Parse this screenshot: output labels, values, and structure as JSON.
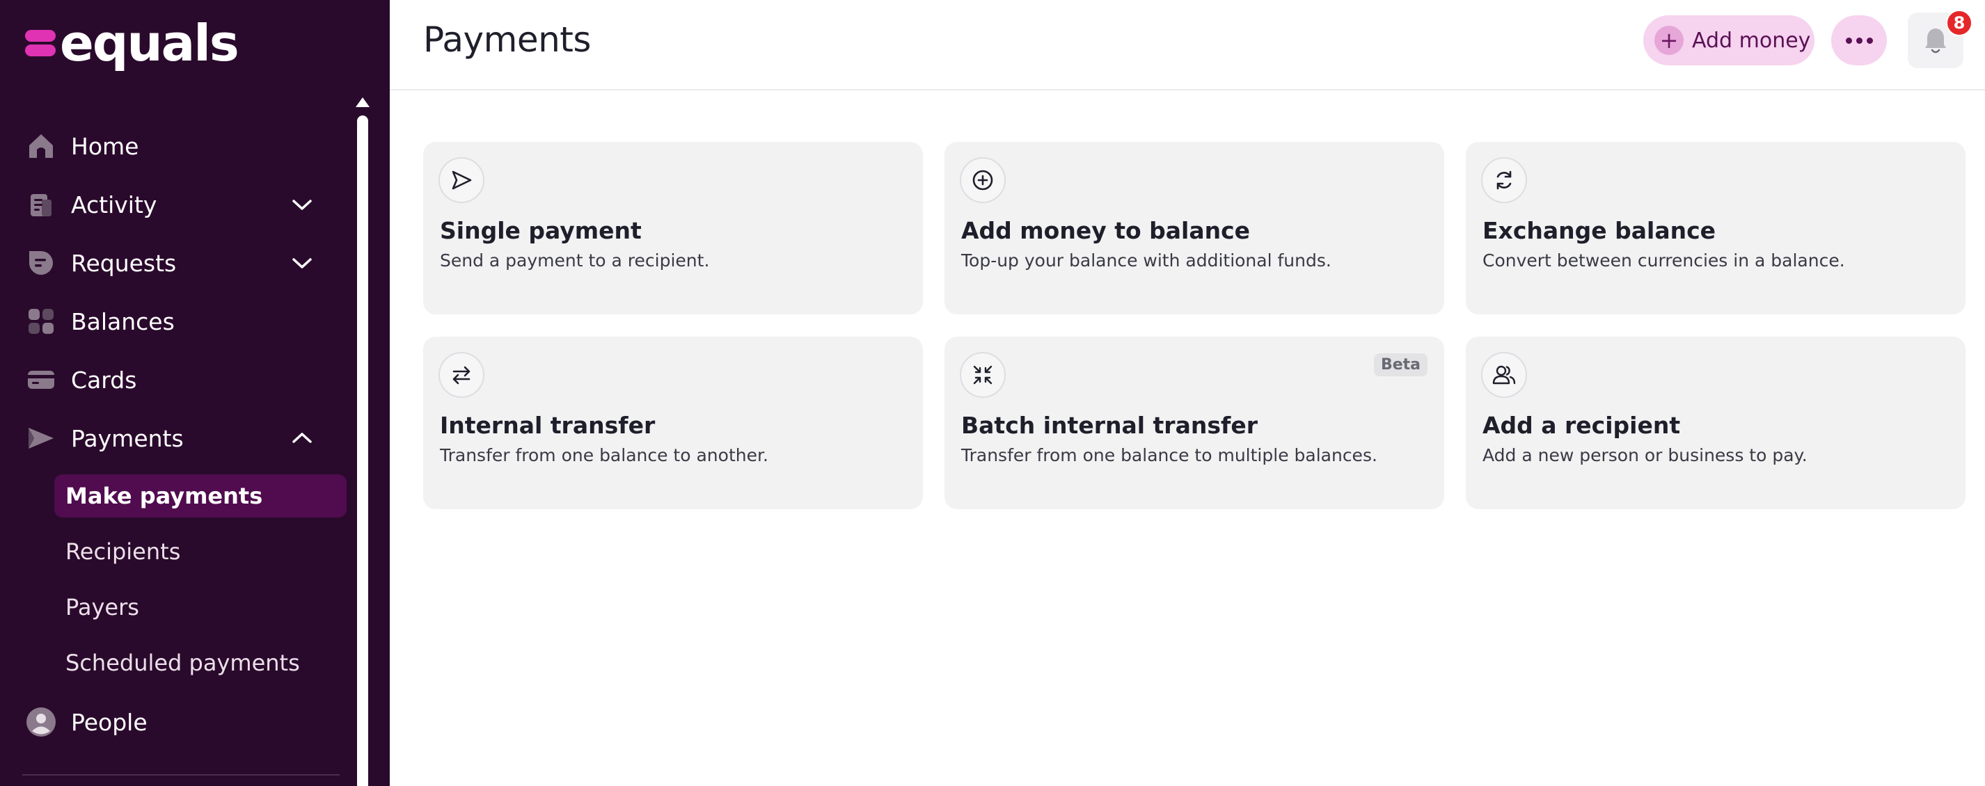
{
  "brand": {
    "name": "equals",
    "accent": "#e033b3",
    "sidebar_bg": "#2a0a2c"
  },
  "sidebar": {
    "items": [
      {
        "label": "Home",
        "icon": "home-icon"
      },
      {
        "label": "Activity",
        "icon": "activity-icon",
        "expandable": true,
        "expanded": false
      },
      {
        "label": "Requests",
        "icon": "requests-icon",
        "expandable": true,
        "expanded": false
      },
      {
        "label": "Balances",
        "icon": "balances-icon"
      },
      {
        "label": "Cards",
        "icon": "card-icon"
      },
      {
        "label": "Payments",
        "icon": "payments-icon",
        "expandable": true,
        "expanded": true
      },
      {
        "label": "People",
        "icon": "person-icon"
      }
    ],
    "payments_subitems": [
      {
        "label": "Make payments",
        "active": true
      },
      {
        "label": "Recipients",
        "active": false
      },
      {
        "label": "Payers",
        "active": false
      },
      {
        "label": "Scheduled payments",
        "active": false
      }
    ]
  },
  "header": {
    "title": "Payments",
    "add_money_label": "Add money",
    "more_icon": "more-dots-icon",
    "notification_icon": "bell-icon",
    "notification_count": "8"
  },
  "cards": [
    {
      "title": "Single payment",
      "description": "Send a payment to a recipient.",
      "icon": "send-icon"
    },
    {
      "title": "Add money to balance",
      "description": "Top-up your balance with additional funds.",
      "icon": "plus-circle-icon"
    },
    {
      "title": "Exchange balance",
      "description": "Convert between currencies in a balance.",
      "icon": "refresh-icon"
    },
    {
      "title": "Internal transfer",
      "description": "Transfer from one balance to another.",
      "icon": "transfer-arrows-icon"
    },
    {
      "title": "Batch internal transfer",
      "description": "Transfer from one balance to multiple balances.",
      "icon": "collapse-arrows-icon",
      "badge": "Beta"
    },
    {
      "title": "Add a recipient",
      "description": "Add a new person or business to pay.",
      "icon": "users-icon"
    }
  ]
}
